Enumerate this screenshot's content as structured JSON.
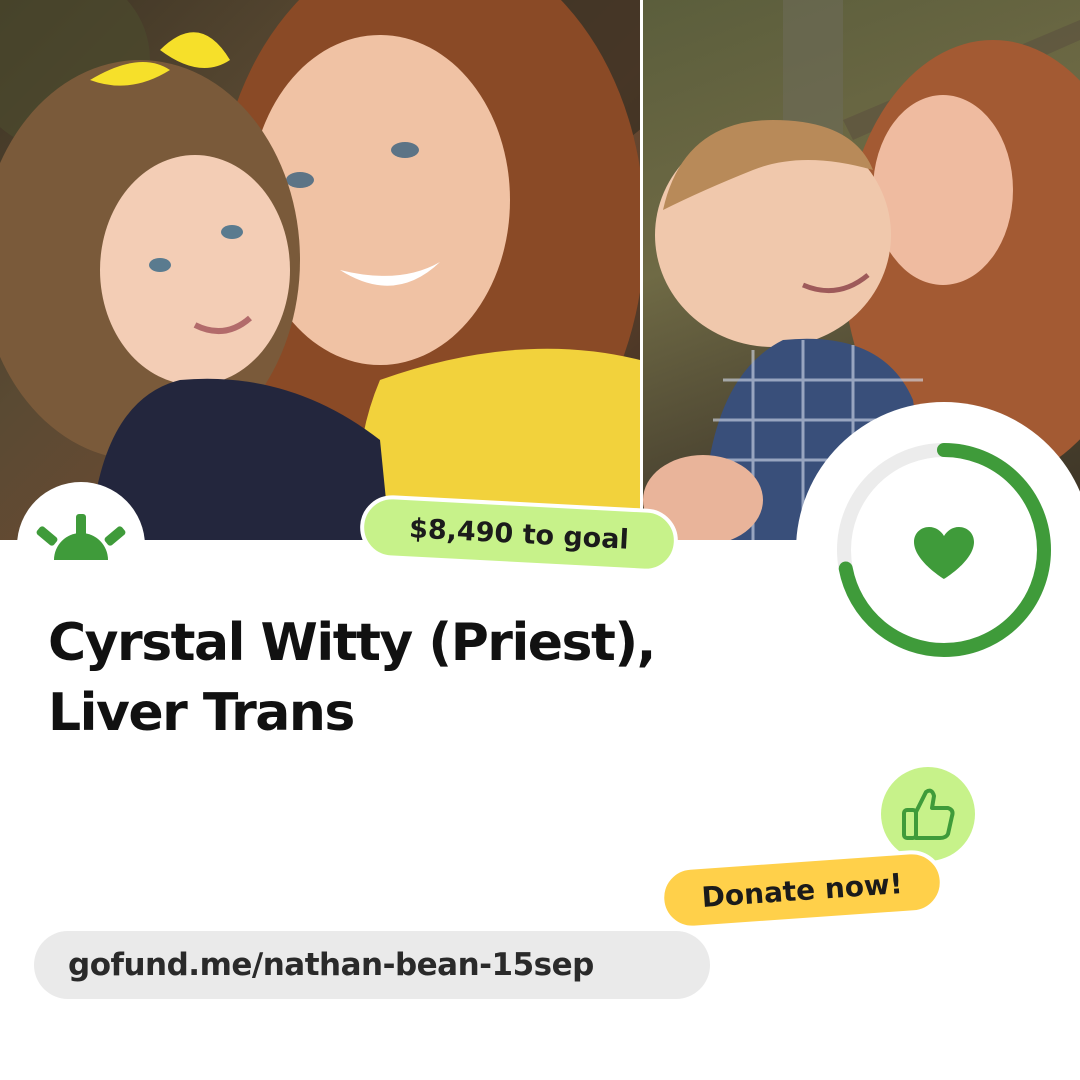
{
  "campaign": {
    "title": "Cyrstal Witty (Priest), Liver Trans",
    "goal_badge": "$8,490 to goal",
    "cta": "Donate now!",
    "url": "gofund.me/nathan-bean-15sep",
    "progress_fraction": 0.72
  },
  "icons": {
    "logo": "gofundme-sunrise-icon",
    "progress_center": "heart-icon",
    "thumbs": "thumbs-up-icon"
  },
  "colors": {
    "brand_green": "#3f9b3a",
    "light_green": "#c7f28a",
    "yellow": "#ffd04a",
    "ring_track": "#ececec"
  }
}
